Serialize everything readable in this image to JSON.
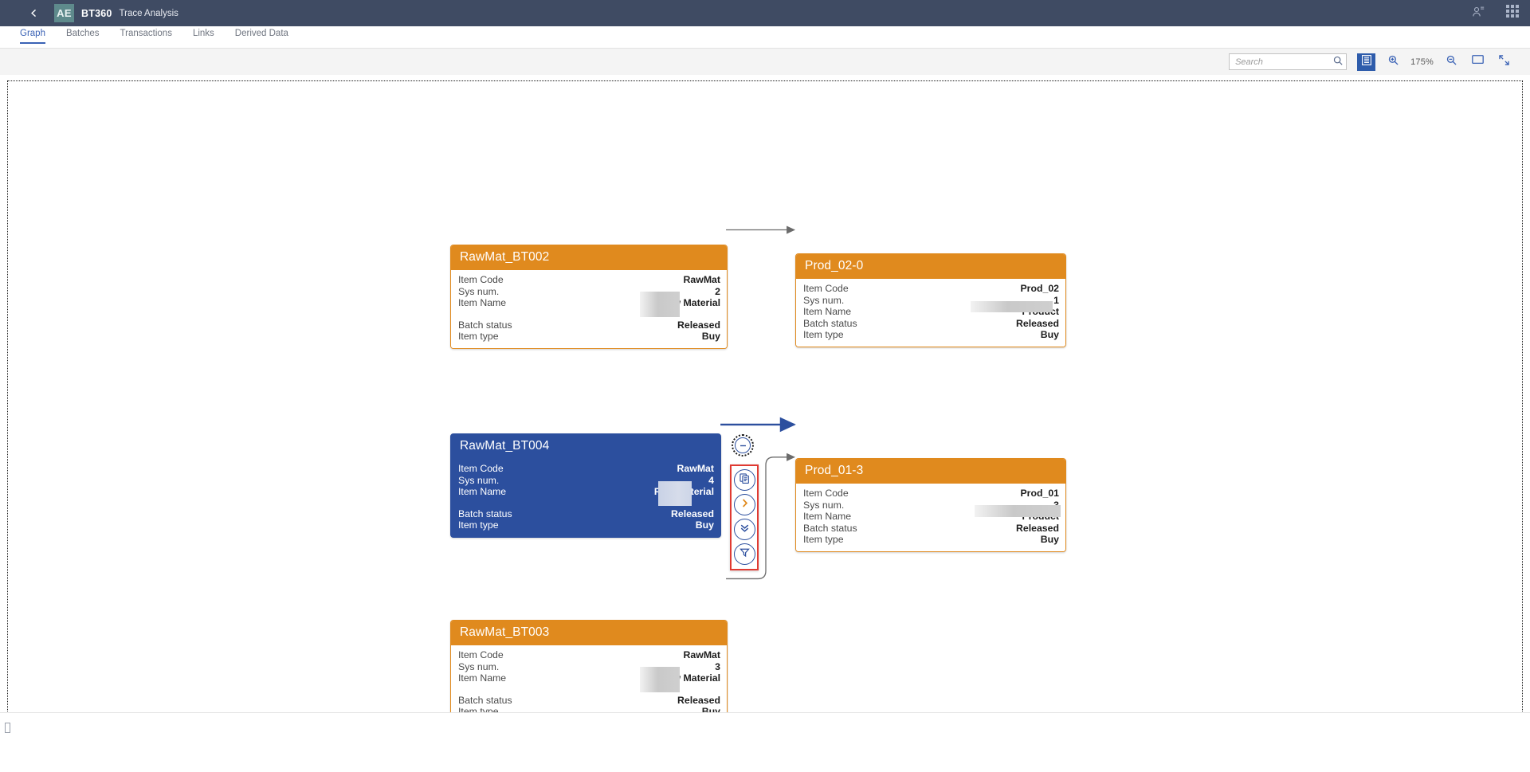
{
  "header": {
    "back_icon": "chevron-left-icon",
    "logo_text": "AE",
    "brand": "BT360",
    "subtitle": "Trace Analysis",
    "user_icon": "user-settings-icon",
    "apps_icon": "grid-apps-icon"
  },
  "tabs": [
    {
      "label": "Graph",
      "active": true
    },
    {
      "label": "Batches",
      "active": false
    },
    {
      "label": "Transactions",
      "active": false
    },
    {
      "label": "Links",
      "active": false
    },
    {
      "label": "Derived Data",
      "active": false
    }
  ],
  "toolbar": {
    "search_value": "",
    "search_placeholder": "Search",
    "search_icon": "search-icon",
    "legend_button": "legend-list-icon",
    "zoom_in_icon": "zoom-in-icon",
    "zoom_level": "175%",
    "zoom_out_icon": "zoom-out-icon",
    "fit_screen_icon": "fit-to-screen-icon",
    "fullscreen_icon": "fullscreen-icon"
  },
  "graph": {
    "field_labels": {
      "item_code": "Item Code",
      "sys_num": "Sys num.",
      "item_name": "Item Name",
      "batch_status": "Batch status",
      "item_type": "Item type"
    },
    "nodes": [
      {
        "id": "rawmat-bt002",
        "title": "RawMat_BT002",
        "state": "normal",
        "item_code": "RawMat",
        "sys_num": "2",
        "item_name": "Raw Material",
        "batch_status": "Released",
        "item_type": "Buy",
        "redacted": true,
        "spacer": true
      },
      {
        "id": "prod-02-0",
        "title": "Prod_02-0",
        "state": "normal",
        "item_code": "Prod_02",
        "sys_num": "1",
        "item_name": "Product",
        "batch_status": "Released",
        "item_type": "Buy",
        "redacted": true,
        "spacer": false
      },
      {
        "id": "rawmat-bt004",
        "title": "RawMat_BT004",
        "state": "selected",
        "item_code": "RawMat",
        "sys_num": "4",
        "item_name": "Raw Material",
        "batch_status": "Released",
        "item_type": "Buy",
        "redacted": true,
        "spacer": true
      },
      {
        "id": "prod-01-3",
        "title": "Prod_01-3",
        "state": "normal",
        "item_code": "Prod_01",
        "sys_num": "3",
        "item_name": "Product",
        "batch_status": "Released",
        "item_type": "Buy",
        "redacted": true,
        "spacer": false
      },
      {
        "id": "rawmat-bt003",
        "title": "RawMat_BT003",
        "state": "normal",
        "item_code": "RawMat",
        "sys_num": "3",
        "item_name": "Raw Material",
        "batch_status": "Released",
        "item_type": "Buy",
        "redacted": true,
        "spacer": true
      }
    ],
    "actions": {
      "collapse_icon": "collapse-minus-circle-icon",
      "duplicate_icon": "copy-documents-icon",
      "expand_right_icon": "chevron-right-circle-icon",
      "expand_down_icon": "double-chevron-down-icon",
      "filter_icon": "funnel-filter-icon"
    },
    "colors": {
      "node_orange": "#e08a1e",
      "node_selected_blue": "#2c4f9e",
      "edge_gray": "#6b6b6b",
      "edge_highlight": "#2c4f9e",
      "action_highlight_red": "#e03a32",
      "accent_blue": "#3a62b5"
    }
  },
  "status_bar": {
    "glyph": ""
  }
}
